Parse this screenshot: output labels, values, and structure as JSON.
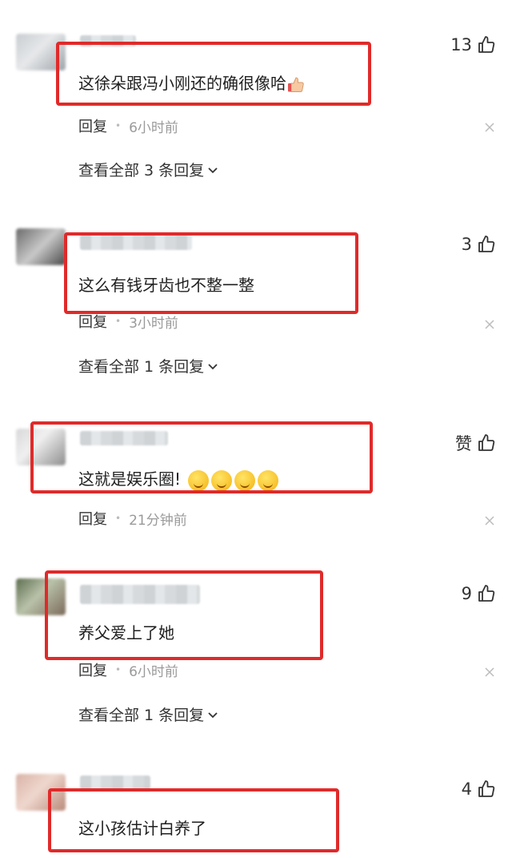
{
  "comments": [
    {
      "text": "这徐朵跟冯小刚还的确很像哈",
      "likes": "13",
      "reply_label": "回复",
      "time": "6小时前",
      "view_all": "查看全部 3 条回复",
      "trailing_emoji": "thumbs-up"
    },
    {
      "text": "这么有钱牙齿也不整一整",
      "likes": "3",
      "reply_label": "回复",
      "time": "3小时前",
      "view_all": "查看全部 1 条回复"
    },
    {
      "text": "这就是娱乐圈!",
      "likes": "赞",
      "reply_label": "回复",
      "time": "21分钟前",
      "trailing_emoji": "smirk-face-x4"
    },
    {
      "text": "养父爱上了她",
      "likes": "9",
      "reply_label": "回复",
      "time": "6小时前",
      "view_all": "查看全部 1 条回复"
    },
    {
      "text": "这小孩估计白养了",
      "likes": "4"
    }
  ],
  "colors": {
    "highlight_box": "#e02a2a",
    "meta_text": "#9a9a9a"
  },
  "icons": {
    "like": "thumbs-up-icon",
    "dismiss": "close-icon",
    "expand": "chevron-down-icon"
  }
}
